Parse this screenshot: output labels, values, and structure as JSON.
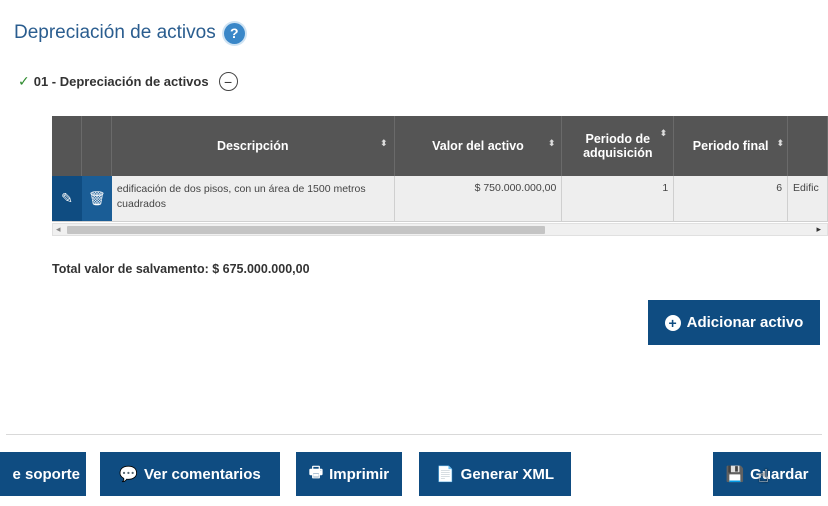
{
  "title": "Depreciación de activos",
  "help_icon": "?",
  "section": {
    "check": "✓",
    "label": "01 - Depreciación de activos",
    "collapse": "−"
  },
  "table": {
    "headers": {
      "descripcion": "Descripción",
      "valor": "Valor del activo",
      "periodo_adq_1": "Periodo de",
      "periodo_adq_2": "adquisición",
      "periodo_final": "Periodo final"
    },
    "rows": [
      {
        "descripcion": "edificación de dos pisos, con un área de 1500 metros cuadrados",
        "valor": "$ 750.000.000,00",
        "periodo_adq": "1",
        "periodo_final": "6",
        "extra": "Edific"
      }
    ]
  },
  "total_label": "Total valor de salvamento: $ 675.000.000,00",
  "add_button": "Adicionar activo",
  "footer": {
    "soporte": "e soporte",
    "comentarios": "Ver comentarios",
    "imprimir": "Imprimir",
    "xml": "Generar XML",
    "guardar": "Guardar"
  },
  "colors": {
    "primary": "#0f4c81",
    "header": "#555555",
    "title": "#2a5d8f"
  }
}
